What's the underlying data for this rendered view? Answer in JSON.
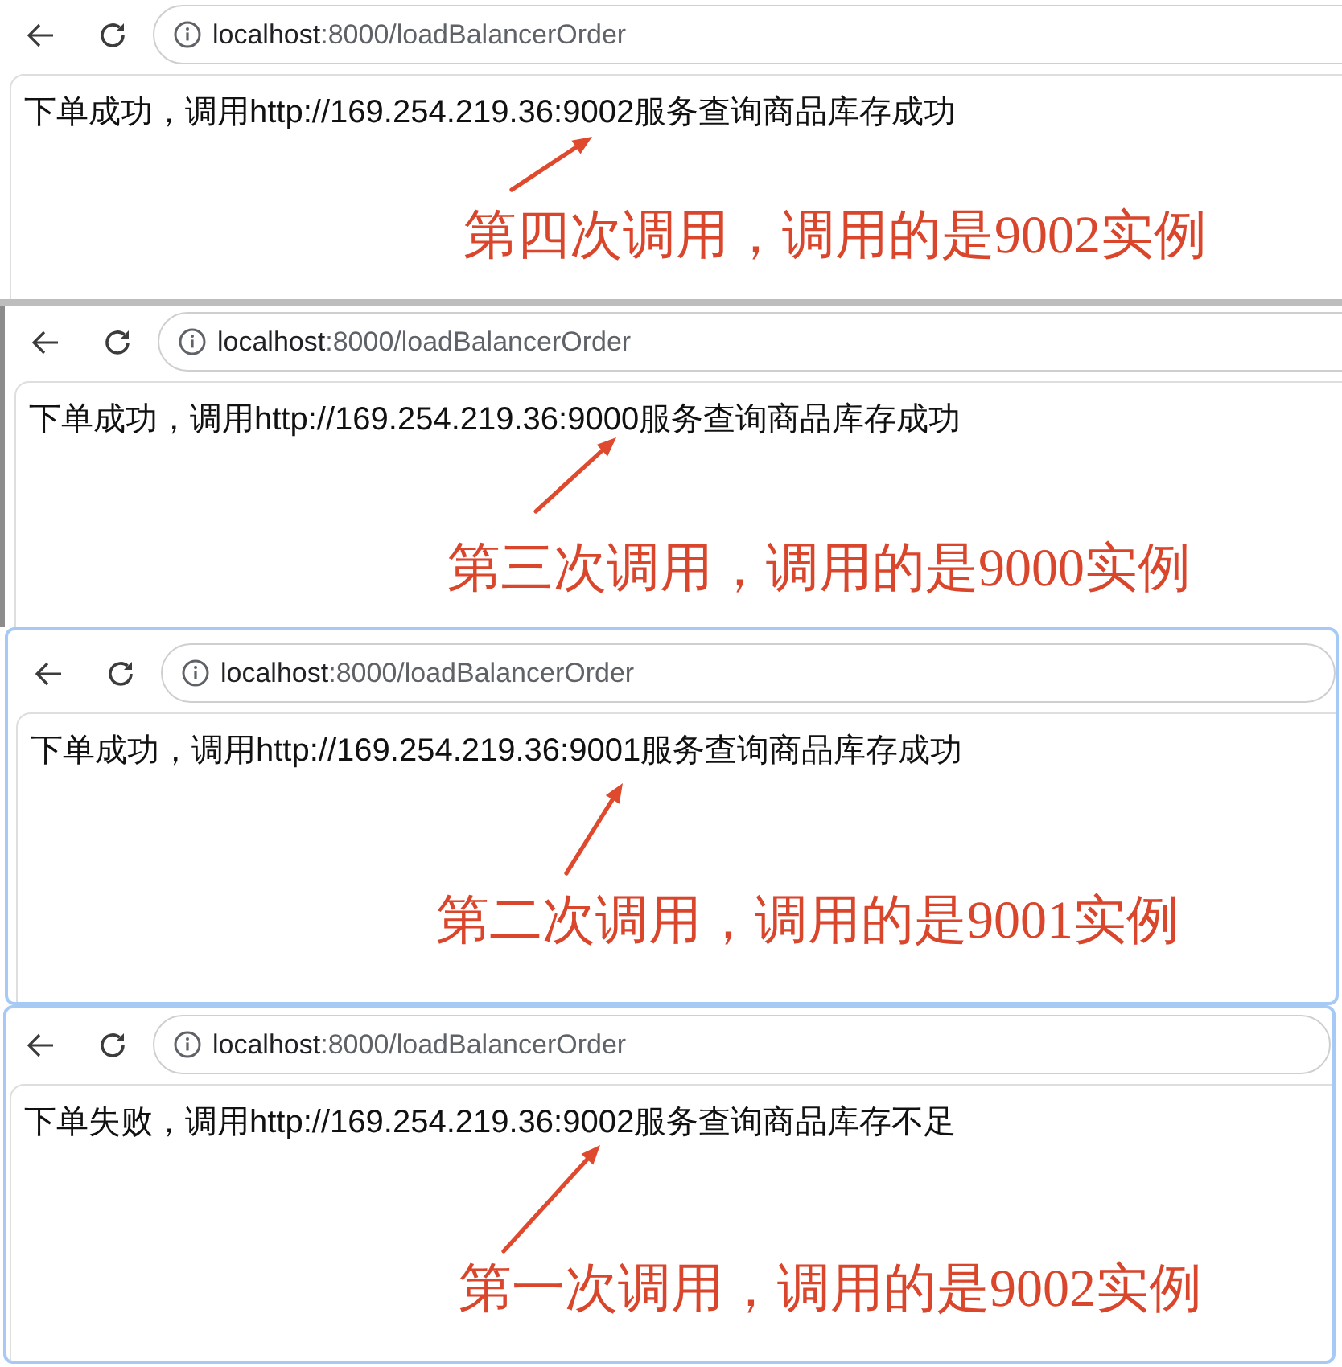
{
  "screenshots": [
    {
      "address": "localhost:8000/loadBalancerOrder",
      "message": "下单成功，调用http://169.254.219.36:9002服务查询商品库存成功",
      "annotation": "第四次调用，调用的是9002实例"
    },
    {
      "address": "localhost:8000/loadBalancerOrder",
      "message": "下单成功，调用http://169.254.219.36:9000服务查询商品库存成功",
      "annotation": "第三次调用，调用的是9000实例"
    },
    {
      "address": "localhost:8000/loadBalancerOrder",
      "message": "下单成功，调用http://169.254.219.36:9001服务查询商品库存成功",
      "annotation": "第二次调用，调用的是9001实例"
    },
    {
      "address": "localhost:8000/loadBalancerOrder",
      "message": "下单失败，调用http://169.254.219.36:9002服务查询商品库存不足",
      "annotation": "第一次调用，调用的是9002实例"
    }
  ]
}
